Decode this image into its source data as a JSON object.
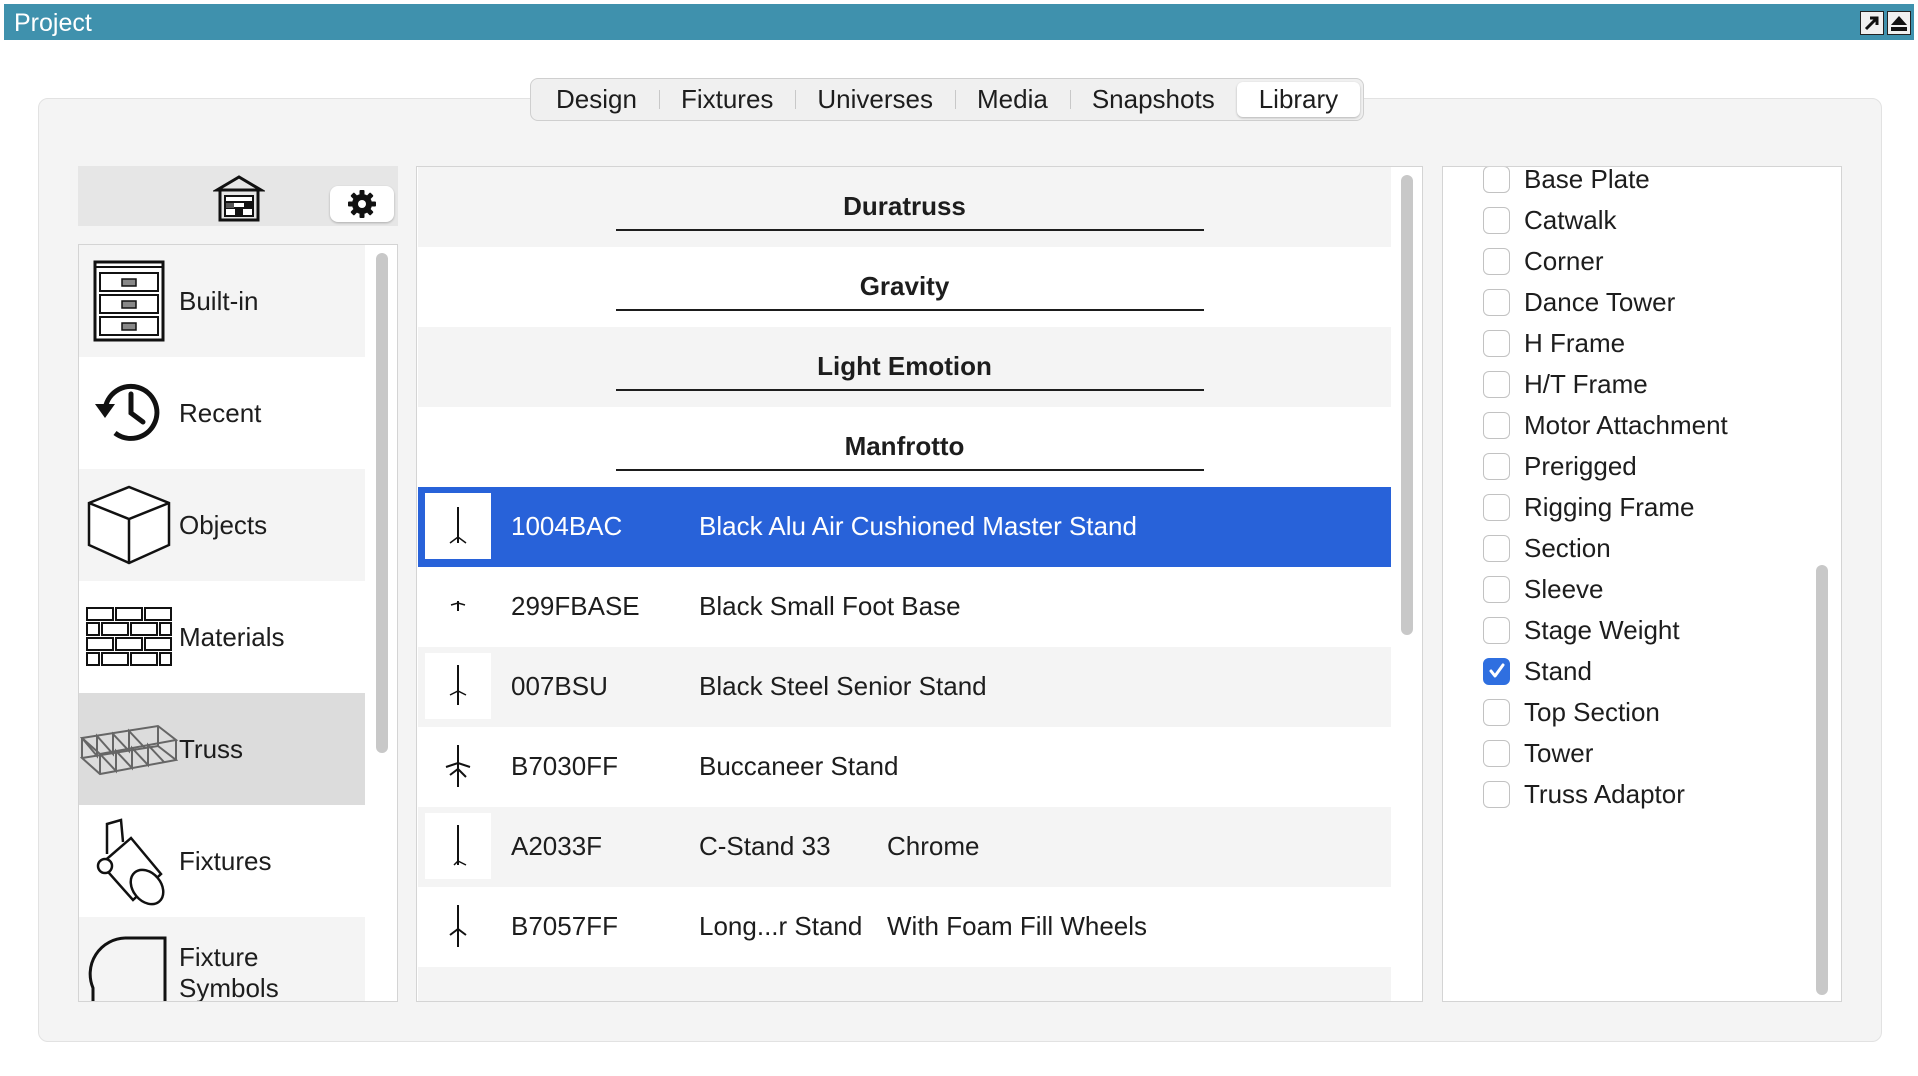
{
  "window": {
    "title": "Project",
    "titlebar_color": "#3f91ad"
  },
  "tabs": [
    {
      "label": "Design",
      "active": false
    },
    {
      "label": "Fixtures",
      "active": false
    },
    {
      "label": "Universes",
      "active": false
    },
    {
      "label": "Media",
      "active": false
    },
    {
      "label": "Snapshots",
      "active": false
    },
    {
      "label": "Library",
      "active": true
    }
  ],
  "library_toolbar": {
    "library_icon": "library-building-icon",
    "settings_icon": "gear-icon"
  },
  "categories": [
    {
      "label": "Built-in",
      "icon": "cabinet-icon"
    },
    {
      "label": "Recent",
      "icon": "history-clock-icon"
    },
    {
      "label": "Objects",
      "icon": "cube-icon"
    },
    {
      "label": "Materials",
      "icon": "brick-wall-icon"
    },
    {
      "label": "Truss",
      "icon": "truss-icon",
      "selected": true
    },
    {
      "label": "Fixtures",
      "icon": "spotlight-icon"
    },
    {
      "label": "Fixture Symbols",
      "icon": "fixture-symbol-icon"
    }
  ],
  "manufacturers": [
    "Duratruss",
    "Gravity",
    "Light Emotion",
    "Manfrotto"
  ],
  "items": [
    {
      "code": "1004BAC",
      "name": "Black Alu Air Cushioned Master Stand",
      "extra": "",
      "selected": true
    },
    {
      "code": "299FBASE",
      "name": "Black Small Foot Base",
      "extra": ""
    },
    {
      "code": "007BSU",
      "name": "Black Steel Senior Stand",
      "extra": ""
    },
    {
      "code": "B7030FF",
      "name": "Buccaneer Stand",
      "extra": ""
    },
    {
      "code": "A2033F",
      "name": "C-Stand 33",
      "extra": "Chrome"
    },
    {
      "code": "B7057FF",
      "name": "Long...r Stand",
      "extra": "With Foam Fill Wheels"
    }
  ],
  "filters": [
    {
      "label": "Base Plate",
      "checked": false
    },
    {
      "label": "Catwalk",
      "checked": false
    },
    {
      "label": "Corner",
      "checked": false
    },
    {
      "label": "Dance Tower",
      "checked": false
    },
    {
      "label": "H Frame",
      "checked": false
    },
    {
      "label": "H/T Frame",
      "checked": false
    },
    {
      "label": "Motor Attachment",
      "checked": false
    },
    {
      "label": "Prerigged",
      "checked": false
    },
    {
      "label": "Rigging Frame",
      "checked": false
    },
    {
      "label": "Section",
      "checked": false
    },
    {
      "label": "Sleeve",
      "checked": false
    },
    {
      "label": "Stage Weight",
      "checked": false
    },
    {
      "label": "Stand",
      "checked": true
    },
    {
      "label": "Top Section",
      "checked": false
    },
    {
      "label": "Tower",
      "checked": false
    },
    {
      "label": "Truss Adaptor",
      "checked": false
    }
  ],
  "colors": {
    "selection": "#2862d9",
    "checkbox_on": "#2f6fe0"
  }
}
